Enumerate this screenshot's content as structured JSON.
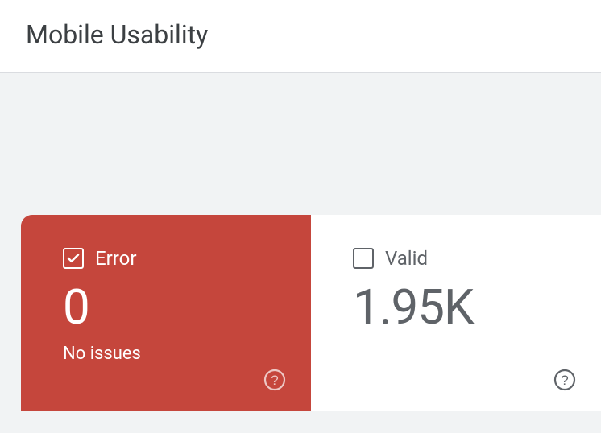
{
  "header": {
    "title": "Mobile Usability"
  },
  "cards": {
    "error": {
      "label": "Error",
      "value": "0",
      "subtext": "No issues"
    },
    "valid": {
      "label": "Valid",
      "value": "1.95K"
    }
  }
}
